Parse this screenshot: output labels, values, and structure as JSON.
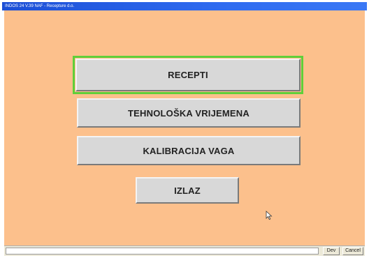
{
  "window": {
    "title": "INDOS 24 V.39 NAF - Recepture d.o."
  },
  "menu": {
    "recepti_label": "RECEPTI",
    "tehnoloska_label": "TEHNOLOŠKA VRIJEMENA",
    "kalibracija_label": "KALIBRACIJA VAGA",
    "izlaz_label": "IZLAZ"
  },
  "statusbar": {
    "field_value": "",
    "button_1_label": "Dev",
    "button_2_label": "Cancel"
  },
  "colors": {
    "client_background": "#fcc08c",
    "button_face": "#d8d8d8",
    "focus_ring": "#5fcf3a",
    "titlebar": "#2f6bf0"
  },
  "icons": {
    "cursor": "mouse-pointer-icon"
  }
}
